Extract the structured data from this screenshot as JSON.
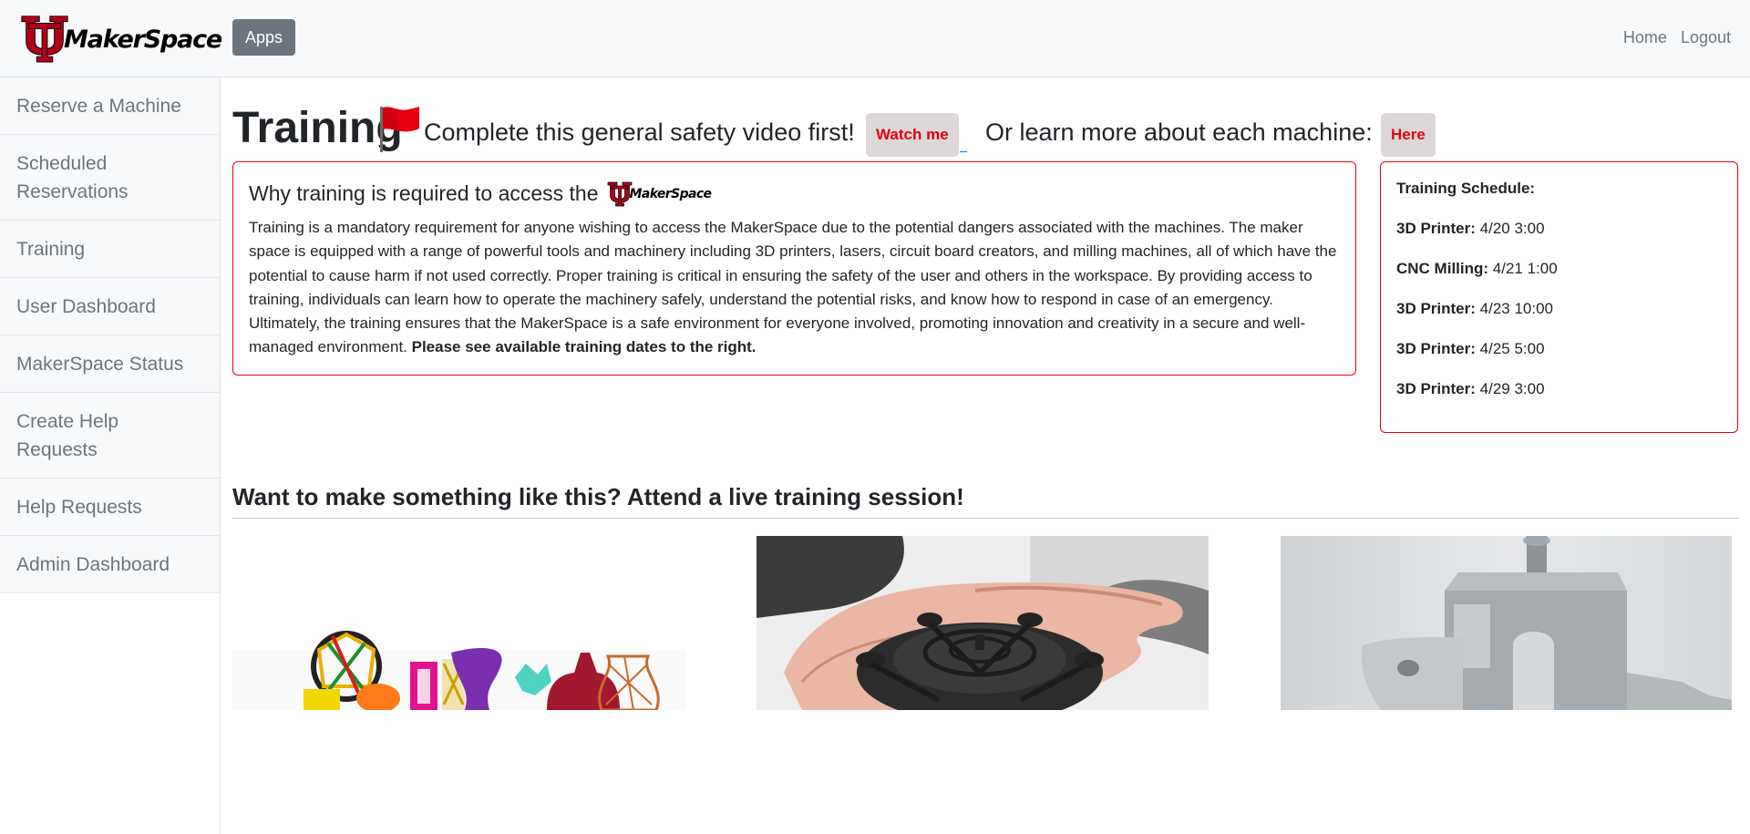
{
  "brand": {
    "logo_text": "MakerSpace",
    "accent": "#e3000f",
    "logo_red": "#b3001b"
  },
  "navbar": {
    "apps_label": "Apps",
    "links": [
      "Home",
      "Logout"
    ]
  },
  "sidebar": {
    "items": [
      {
        "label": "Reserve a Machine"
      },
      {
        "label": "Scheduled Reservations"
      },
      {
        "label": "Training"
      },
      {
        "label": "User Dashboard"
      },
      {
        "label": "MakerSpace Status"
      },
      {
        "label": "Create Help Requests"
      },
      {
        "label": "Help Requests"
      },
      {
        "label": "Admin Dashboard"
      }
    ]
  },
  "main": {
    "title": "Training",
    "flag_icon": "red-flag-icon",
    "subtitle": "Complete this general safety video first!",
    "watch_label": "Watch me",
    "subtitle2": "Or learn more about each machine:",
    "here_label": "Here",
    "why_title": "Why training is required to access the",
    "why_text": "Training is a mandatory requirement for anyone wishing to access the MakerSpace due to the potential dangers associated with the machines. The maker space is equipped with a range of powerful tools and machinery including 3D printers, lasers, circuit board creators, and milling machines, all of which have the potential to cause harm if not used correctly. Proper training is critical in ensuring the safety of the user and others in the workspace. By providing access to training, individuals can learn how to operate the machinery safely, understand the potential risks, and know how to respond in case of an emergency. Ultimately, the training ensures that the MakerSpace is a safe environment for everyone involved, promoting innovation and creativity in a secure and well-managed environment.",
    "why_bold": "Please see available training dates to the right.",
    "schedule_title": "Training Schedule:",
    "schedule": [
      {
        "machine": "3D Printer:",
        "time": "4/20 3:00"
      },
      {
        "machine": "CNC Milling:",
        "time": "4/21 1:00"
      },
      {
        "machine": "3D Printer:",
        "time": "4/23 10:00"
      },
      {
        "machine": "3D Printer:",
        "time": "4/25 5:00"
      },
      {
        "machine": "3D Printer:",
        "time": "4/29 3:00"
      }
    ],
    "cta": "Want to make something like this? Attend a live training session!"
  }
}
